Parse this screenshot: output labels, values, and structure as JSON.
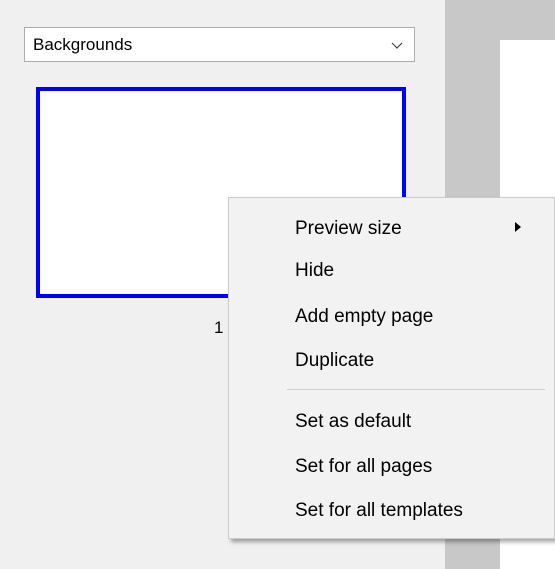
{
  "panel": {
    "dropdown": {
      "selected": "Backgrounds"
    },
    "thumbnail": {
      "page_number": "1",
      "selection_color": "#0000ff"
    }
  },
  "context_menu": {
    "items": [
      {
        "label": "Preview size",
        "has_submenu": true
      },
      {
        "label": "Hide"
      },
      {
        "label": "Add empty page"
      },
      {
        "label": "Duplicate"
      },
      {
        "label": "Set as default"
      },
      {
        "label": "Set for all pages"
      },
      {
        "label": "Set for all templates"
      }
    ]
  },
  "icons": {
    "dropdown": "chevron-down-icon",
    "submenu": "submenu-arrow-icon"
  }
}
